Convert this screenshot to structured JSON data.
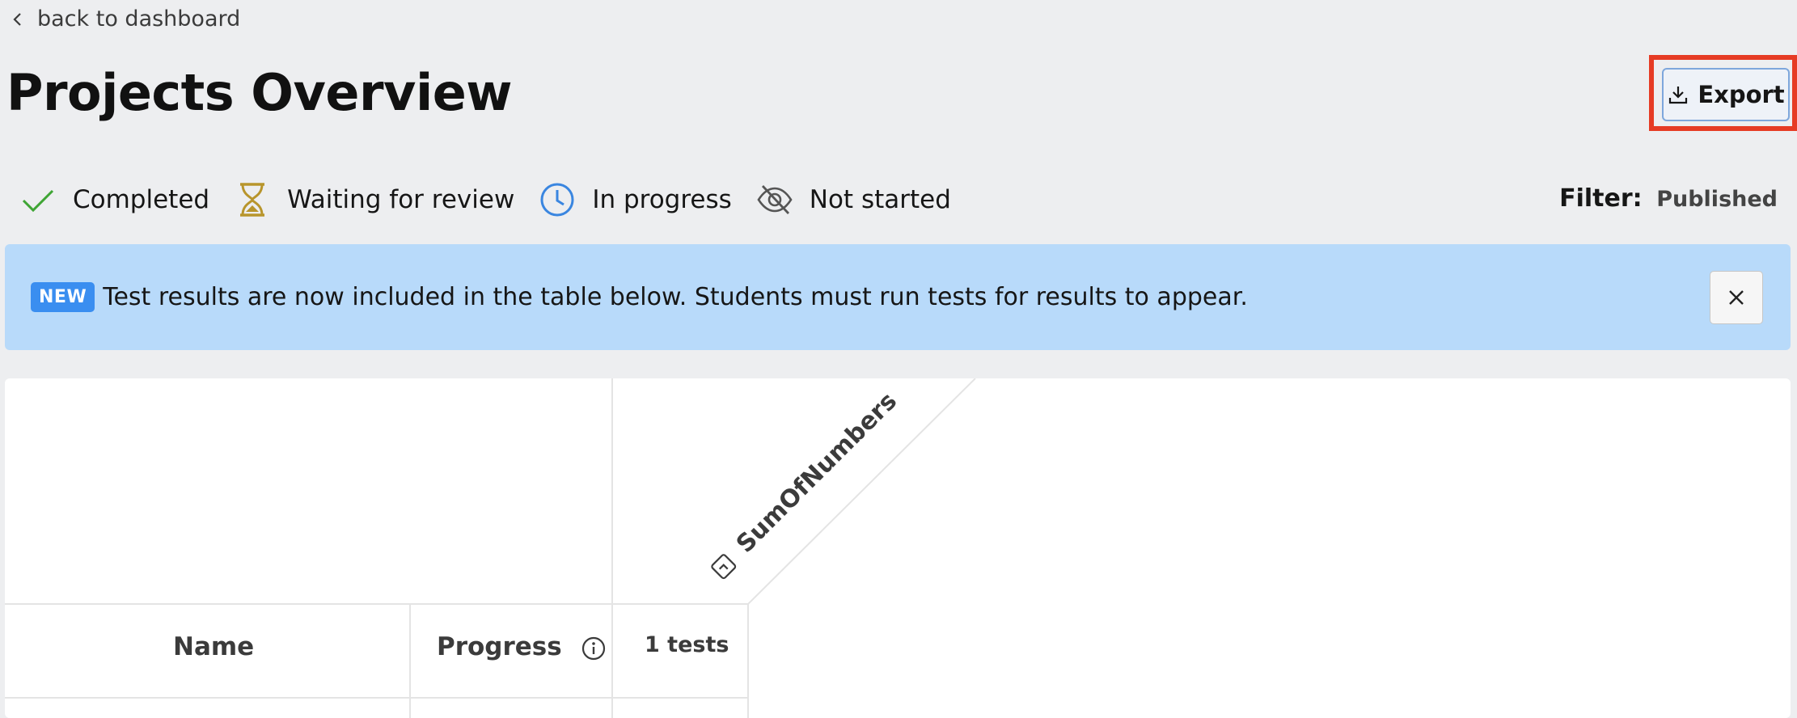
{
  "nav": {
    "back_label": "back to dashboard"
  },
  "page": {
    "title": "Projects Overview"
  },
  "toolbar": {
    "export_label": "Export"
  },
  "legend": [
    {
      "label": "Completed",
      "icon": "checkmark-icon",
      "color": "#3fa535"
    },
    {
      "label": "Waiting for review",
      "icon": "hourglass-icon",
      "color": "#b8952c"
    },
    {
      "label": "In progress",
      "icon": "clock-icon",
      "color": "#3a86e0"
    },
    {
      "label": "Not started",
      "icon": "eye-off-icon",
      "color": "#555555"
    }
  ],
  "filter": {
    "label": "Filter:",
    "value": "Published"
  },
  "banner": {
    "badge": "NEW",
    "text": "Test results are now included in the table below. Students must run tests for results to appear."
  },
  "table": {
    "project_column": {
      "name": "SumOfNumbers",
      "icon": "project-icon"
    },
    "headers": {
      "name": "Name",
      "progress": "Progress",
      "tests": "1 tests"
    }
  },
  "colors": {
    "background": "#edeef0",
    "banner": "#b8dafa",
    "badge": "#3a8ef0",
    "highlight": "#e63b24"
  }
}
